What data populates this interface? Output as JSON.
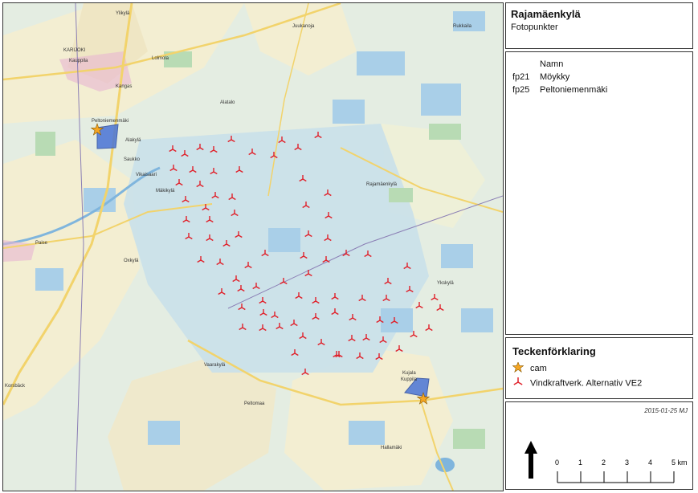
{
  "map": {
    "place_labels": [
      "Ylikylä",
      "KARIJOKI",
      "Kauppila",
      "Kangas",
      "Alakylä",
      "Peltoniemenmäki",
      "Lolmola",
      "Saukko",
      "Vikaisaari",
      "Mäkikylä",
      "Alatalo",
      "Korsbäck",
      "Paise",
      "Oxkylä",
      "Vaarakylä",
      "Rajamäenkylä",
      "Kujala",
      "Juukanoja",
      "Kuppila",
      "Ykskylä",
      "Rukkaila",
      "Peltomaa",
      "Hallamäki"
    ],
    "turbines_count": 77
  },
  "title_panel": {
    "title": "Rajamäenkylä",
    "subtitle": "Fotopunkter"
  },
  "names_panel": {
    "header": "Namn",
    "rows": [
      {
        "code": "fp21",
        "name": "Möykky"
      },
      {
        "code": "fp25",
        "name": "Peltoniemenmäki"
      }
    ]
  },
  "legend": {
    "title": "Teckenförklaring",
    "items": [
      {
        "symbol": "star",
        "label": "cam",
        "color": "#f5a623"
      },
      {
        "symbol": "turbine",
        "label": "Vindkraftverk. Alternativ VE2",
        "color": "#e0202a"
      }
    ]
  },
  "scale_panel": {
    "credit": "2015-01-25 MJ",
    "ticks": [
      "0",
      "1",
      "2",
      "3",
      "4",
      "5 km"
    ]
  },
  "colors": {
    "water": "#a9cfe8",
    "field": "#f3eed2",
    "forest": "#e4ede2",
    "road_yellow": "#f2d36b",
    "viewshed": "#4a74d6",
    "urban": "#e7b6d2"
  }
}
